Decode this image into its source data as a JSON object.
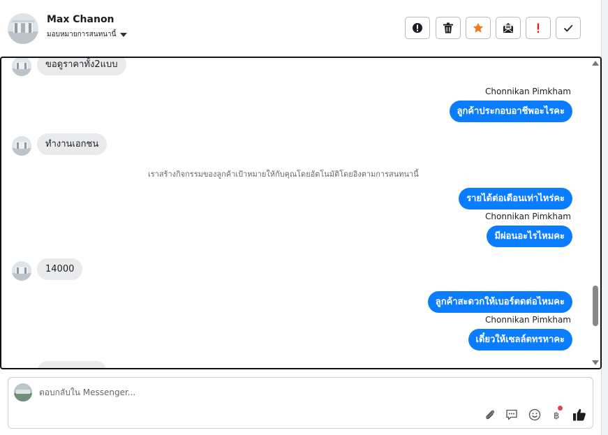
{
  "header": {
    "contact_name": "Max Chanon",
    "assign_label": "มอบหมายการสนทนานี้",
    "toolbar": {
      "spam_icon": "alert-circle-icon",
      "delete_icon": "trash-icon",
      "star_icon": "star-icon",
      "unread_icon": "mail-open-icon",
      "important_icon": "exclamation-icon",
      "done_icon": "checkmark-icon"
    }
  },
  "thread": {
    "messages": [
      {
        "direction": "in",
        "text": "ขอดูราคาทั้ง2แบบ"
      },
      {
        "direction": "out",
        "sender": "Chonnikan Pimkham",
        "text": "ลูกค้าประกอบอาชีพอะไรคะ"
      },
      {
        "direction": "in",
        "text": "ทำงานเอกชน"
      },
      {
        "direction": "system",
        "text": "เราสร้างกิจกรรมของลูกค้าเป้าหมายให้กับคุณโดยอัตโนมัติโดยอิงตามการสนทนานี้"
      },
      {
        "direction": "out",
        "text": "รายได้ต่อเดือนเท่าไหร่คะ"
      },
      {
        "direction": "out",
        "sender": "Chonnikan Pimkham",
        "text": "มีผ่อนอะไรไหมคะ"
      },
      {
        "direction": "in",
        "text": "14000"
      },
      {
        "direction": "out",
        "text": "ลูกค้าสะดวกให้เบอร์ตดต่อไหมคะ"
      },
      {
        "direction": "out",
        "sender": "Chonnikan Pimkham",
        "text": "เดี๋ยวให้เซลล์ตทรหาคะ"
      }
    ]
  },
  "composer": {
    "placeholder": "ตอบกลับใน Messenger...",
    "tools": [
      "paperclip-icon",
      "saved-reply-icon",
      "emoji-icon",
      "baht-icon",
      "like-icon"
    ]
  },
  "colors": {
    "outgoing_bubble": "#0a7cff",
    "incoming_bubble": "#e9eaec",
    "star": "#f07b1d",
    "important": "#e02020",
    "notification_dot": "#e0415b"
  }
}
